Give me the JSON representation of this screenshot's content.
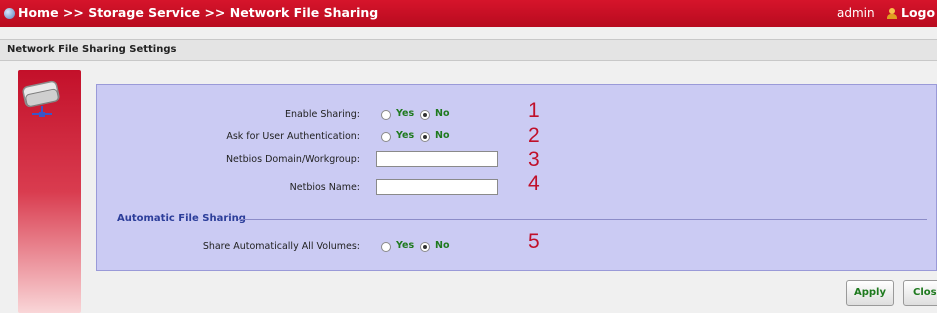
{
  "header": {
    "breadcrumb": "Home >> Storage Service >> Network File Sharing",
    "username": "admin",
    "logout": "Logo"
  },
  "section_title": "Network File Sharing Settings",
  "settings": {
    "enable_sharing": {
      "label": "Enable Sharing:",
      "options": [
        "Yes",
        "No"
      ],
      "selected": "No",
      "marker": "1"
    },
    "user_auth": {
      "label": "Ask for User Authentication:",
      "options": [
        "Yes",
        "No"
      ],
      "selected": "No",
      "marker": "2"
    },
    "workgroup": {
      "label": "Netbios Domain/Workgroup:",
      "value": "",
      "marker": "3"
    },
    "netbios_name": {
      "label": "Netbios Name:",
      "value": "",
      "marker": "4"
    }
  },
  "automatic": {
    "title": "Automatic File Sharing",
    "share_all": {
      "label": "Share Automatically All Volumes:",
      "options": [
        "Yes",
        "No"
      ],
      "selected": "No",
      "marker": "5"
    }
  },
  "buttons": {
    "apply": "Apply",
    "close": "Close"
  },
  "colors": {
    "brand": "#c8102e",
    "panel": "#cbcbf3",
    "option_text": "#1f7a1f",
    "marker": "#c0102a"
  },
  "icons": {
    "home": "globe-icon",
    "user": "user-icon",
    "drive": "network-drive-icon"
  }
}
